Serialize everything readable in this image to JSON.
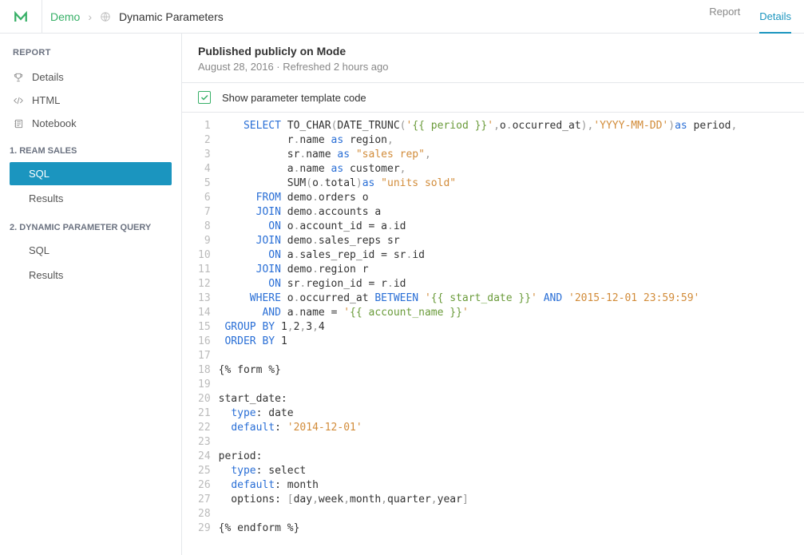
{
  "breadcrumb": {
    "root": "Demo",
    "page": "Dynamic Parameters"
  },
  "tabs": {
    "report": "Report",
    "details": "Details"
  },
  "sidebar": {
    "header": "REPORT",
    "items": [
      {
        "label": "Details"
      },
      {
        "label": "HTML"
      },
      {
        "label": "Notebook"
      }
    ],
    "sections": [
      {
        "title": "1. REAM SALES",
        "items": [
          {
            "label": "SQL",
            "active": true
          },
          {
            "label": "Results"
          }
        ]
      },
      {
        "title": "2. DYNAMIC PARAMETER QUERY",
        "items": [
          {
            "label": "SQL"
          },
          {
            "label": "Results"
          }
        ]
      }
    ]
  },
  "content": {
    "published_title": "Published publicly on Mode",
    "published_sub": "August 28, 2016 · Refreshed 2 hours ago",
    "checkbox_label": "Show parameter template code"
  },
  "code": {
    "lines": [
      {
        "n": 1,
        "t": [
          [
            "    ",
            ""
          ],
          [
            "SELECT",
            "kw"
          ],
          [
            " ",
            ""
          ],
          [
            "TO_CHAR",
            "fn"
          ],
          [
            "(",
            "punc"
          ],
          [
            "DATE_TRUNC",
            "fn"
          ],
          [
            "(",
            "punc"
          ],
          [
            "'",
            "str"
          ],
          [
            "{{ period }}",
            "tmpl"
          ],
          [
            "'",
            "str"
          ],
          [
            ",",
            "punc"
          ],
          [
            "o",
            "col"
          ],
          [
            ".",
            "punc"
          ],
          [
            "occurred_at",
            "col"
          ],
          [
            ")",
            "punc"
          ],
          [
            ",",
            "punc"
          ],
          [
            "'YYYY-MM-DD'",
            "str"
          ],
          [
            ")",
            "punc"
          ],
          [
            "as",
            "kw"
          ],
          [
            " period",
            "col"
          ],
          [
            ",",
            "punc"
          ]
        ]
      },
      {
        "n": 2,
        "t": [
          [
            "           r",
            ""
          ],
          [
            ".",
            "punc"
          ],
          [
            "name",
            "col"
          ],
          [
            " ",
            ""
          ],
          [
            "as",
            "kw"
          ],
          [
            " region",
            "col"
          ],
          [
            ",",
            "punc"
          ]
        ]
      },
      {
        "n": 3,
        "t": [
          [
            "           sr",
            ""
          ],
          [
            ".",
            "punc"
          ],
          [
            "name",
            "col"
          ],
          [
            " ",
            ""
          ],
          [
            "as",
            "kw"
          ],
          [
            " ",
            ""
          ],
          [
            "\"sales rep\"",
            "str"
          ],
          [
            ",",
            "punc"
          ]
        ]
      },
      {
        "n": 4,
        "t": [
          [
            "           a",
            ""
          ],
          [
            ".",
            "punc"
          ],
          [
            "name",
            "col"
          ],
          [
            " ",
            ""
          ],
          [
            "as",
            "kw"
          ],
          [
            " customer",
            "col"
          ],
          [
            ",",
            "punc"
          ]
        ]
      },
      {
        "n": 5,
        "t": [
          [
            "           ",
            ""
          ],
          [
            "SUM",
            "fn"
          ],
          [
            "(",
            "punc"
          ],
          [
            "o",
            "col"
          ],
          [
            ".",
            "punc"
          ],
          [
            "total",
            "col"
          ],
          [
            ")",
            "punc"
          ],
          [
            "as",
            "kw"
          ],
          [
            " ",
            ""
          ],
          [
            "\"units sold\"",
            "str"
          ]
        ]
      },
      {
        "n": 6,
        "t": [
          [
            "      ",
            ""
          ],
          [
            "FROM",
            "kw"
          ],
          [
            " demo",
            "col"
          ],
          [
            ".",
            "punc"
          ],
          [
            "orders o",
            "col"
          ]
        ]
      },
      {
        "n": 7,
        "t": [
          [
            "      ",
            ""
          ],
          [
            "JOIN",
            "kw"
          ],
          [
            " demo",
            "col"
          ],
          [
            ".",
            "punc"
          ],
          [
            "accounts a",
            "col"
          ]
        ]
      },
      {
        "n": 8,
        "t": [
          [
            "        ",
            ""
          ],
          [
            "ON",
            "kw"
          ],
          [
            " o",
            "col"
          ],
          [
            ".",
            "punc"
          ],
          [
            "account_id ",
            "col"
          ],
          [
            "=",
            "op"
          ],
          [
            " a",
            "col"
          ],
          [
            ".",
            "punc"
          ],
          [
            "id",
            "col"
          ]
        ]
      },
      {
        "n": 9,
        "t": [
          [
            "      ",
            ""
          ],
          [
            "JOIN",
            "kw"
          ],
          [
            " demo",
            "col"
          ],
          [
            ".",
            "punc"
          ],
          [
            "sales_reps sr",
            "col"
          ]
        ]
      },
      {
        "n": 10,
        "t": [
          [
            "        ",
            ""
          ],
          [
            "ON",
            "kw"
          ],
          [
            " a",
            "col"
          ],
          [
            ".",
            "punc"
          ],
          [
            "sales_rep_id ",
            "col"
          ],
          [
            "=",
            "op"
          ],
          [
            " sr",
            "col"
          ],
          [
            ".",
            "punc"
          ],
          [
            "id",
            "col"
          ]
        ]
      },
      {
        "n": 11,
        "t": [
          [
            "      ",
            ""
          ],
          [
            "JOIN",
            "kw"
          ],
          [
            " demo",
            "col"
          ],
          [
            ".",
            "punc"
          ],
          [
            "region r",
            "col"
          ]
        ]
      },
      {
        "n": 12,
        "t": [
          [
            "        ",
            ""
          ],
          [
            "ON",
            "kw"
          ],
          [
            " sr",
            "col"
          ],
          [
            ".",
            "punc"
          ],
          [
            "region_id ",
            "col"
          ],
          [
            "=",
            "op"
          ],
          [
            " r",
            "col"
          ],
          [
            ".",
            "punc"
          ],
          [
            "id",
            "col"
          ]
        ]
      },
      {
        "n": 13,
        "t": [
          [
            "     ",
            ""
          ],
          [
            "WHERE",
            "kw"
          ],
          [
            " o",
            "col"
          ],
          [
            ".",
            "punc"
          ],
          [
            "occurred_at ",
            "col"
          ],
          [
            "BETWEEN",
            "kw"
          ],
          [
            " ",
            ""
          ],
          [
            "'",
            "str"
          ],
          [
            "{{ start_date }}",
            "tmpl"
          ],
          [
            "'",
            "str"
          ],
          [
            " ",
            ""
          ],
          [
            "AND",
            "kw"
          ],
          [
            " ",
            ""
          ],
          [
            "'2015-12-01 23:59:59'",
            "str"
          ]
        ]
      },
      {
        "n": 14,
        "t": [
          [
            "       ",
            ""
          ],
          [
            "AND",
            "kw"
          ],
          [
            " a",
            "col"
          ],
          [
            ".",
            "punc"
          ],
          [
            "name ",
            "col"
          ],
          [
            "=",
            "op"
          ],
          [
            " ",
            ""
          ],
          [
            "'",
            "str"
          ],
          [
            "{{ account_name }}",
            "tmpl"
          ],
          [
            "'",
            "str"
          ]
        ]
      },
      {
        "n": 15,
        "t": [
          [
            " ",
            ""
          ],
          [
            "GROUP BY",
            "kw"
          ],
          [
            " ",
            ""
          ],
          [
            "1",
            "num"
          ],
          [
            ",",
            "punc"
          ],
          [
            "2",
            "num"
          ],
          [
            ",",
            "punc"
          ],
          [
            "3",
            "num"
          ],
          [
            ",",
            "punc"
          ],
          [
            "4",
            "num"
          ]
        ]
      },
      {
        "n": 16,
        "t": [
          [
            " ",
            ""
          ],
          [
            "ORDER BY",
            "kw"
          ],
          [
            " ",
            ""
          ],
          [
            "1",
            "num"
          ]
        ]
      },
      {
        "n": 17,
        "t": [
          [
            "",
            ""
          ]
        ]
      },
      {
        "n": 18,
        "t": [
          [
            "{% form %}",
            "col"
          ]
        ]
      },
      {
        "n": 19,
        "t": [
          [
            "",
            ""
          ]
        ]
      },
      {
        "n": 20,
        "t": [
          [
            "start_date:",
            "col"
          ]
        ]
      },
      {
        "n": 21,
        "t": [
          [
            "  ",
            ""
          ],
          [
            "type",
            "yaml-key"
          ],
          [
            ": date",
            "yaml-val"
          ]
        ]
      },
      {
        "n": 22,
        "t": [
          [
            "  ",
            ""
          ],
          [
            "default",
            "yaml-key"
          ],
          [
            ": ",
            "yaml-val"
          ],
          [
            "'2014-12-01'",
            "str"
          ]
        ]
      },
      {
        "n": 23,
        "t": [
          [
            "",
            ""
          ]
        ]
      },
      {
        "n": 24,
        "t": [
          [
            "period:",
            "col"
          ]
        ]
      },
      {
        "n": 25,
        "t": [
          [
            "  ",
            ""
          ],
          [
            "type",
            "yaml-key"
          ],
          [
            ": select",
            "yaml-val"
          ]
        ]
      },
      {
        "n": 26,
        "t": [
          [
            "  ",
            ""
          ],
          [
            "default",
            "yaml-key"
          ],
          [
            ": month",
            "yaml-val"
          ]
        ]
      },
      {
        "n": 27,
        "t": [
          [
            "  options: ",
            "col"
          ],
          [
            "[",
            "punc"
          ],
          [
            "day",
            "col"
          ],
          [
            ",",
            "punc"
          ],
          [
            "week",
            "col"
          ],
          [
            ",",
            "punc"
          ],
          [
            "month",
            "col"
          ],
          [
            ",",
            "punc"
          ],
          [
            "quarter",
            "col"
          ],
          [
            ",",
            "punc"
          ],
          [
            "year",
            "col"
          ],
          [
            "]",
            "punc"
          ]
        ]
      },
      {
        "n": 28,
        "t": [
          [
            "",
            ""
          ]
        ]
      },
      {
        "n": 29,
        "t": [
          [
            "{% endform %}",
            "col"
          ]
        ]
      }
    ]
  }
}
